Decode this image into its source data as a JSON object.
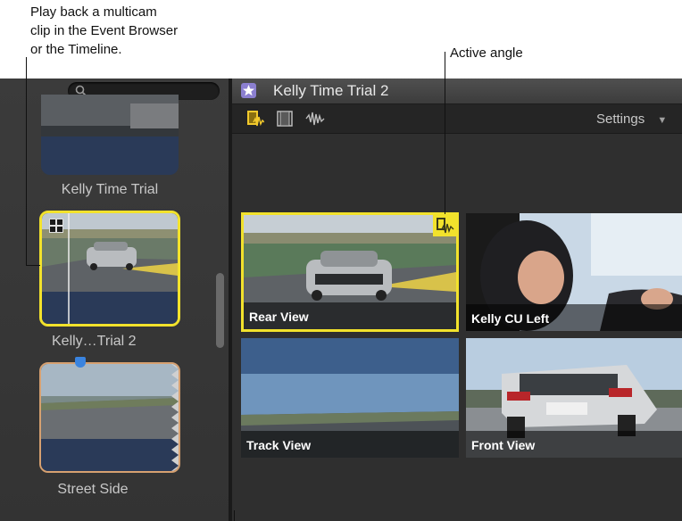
{
  "callouts": {
    "multicam_text_line1": "Play back a multicam",
    "multicam_text_line2": "clip in the Event Browser",
    "multicam_text_line3": "or the Timeline.",
    "active_angle_text": "Active angle"
  },
  "sidebar": {
    "search_placeholder": "",
    "clips": [
      {
        "label": "Kelly Time Trial"
      },
      {
        "label": "Kelly…Trial 2"
      },
      {
        "label": "Street Side"
      }
    ]
  },
  "viewer": {
    "title": "Kelly Time Trial 2",
    "settings_label": "Settings",
    "angles": [
      {
        "label": "Rear View",
        "active": true
      },
      {
        "label": "Kelly CU Left",
        "active": false
      },
      {
        "label": "Track View",
        "active": false
      },
      {
        "label": "Front View",
        "active": false
      }
    ]
  },
  "colors": {
    "active_highlight": "#f2e22c",
    "panel_background": "#3c3c3c",
    "viewer_background": "#2f2f2f"
  },
  "icons": [
    "search-icon",
    "grid-icon",
    "star-icon",
    "video-audio-icon",
    "video-icon",
    "audio-waveform-icon",
    "dropdown-arrow-icon",
    "active-angle-icon"
  ]
}
